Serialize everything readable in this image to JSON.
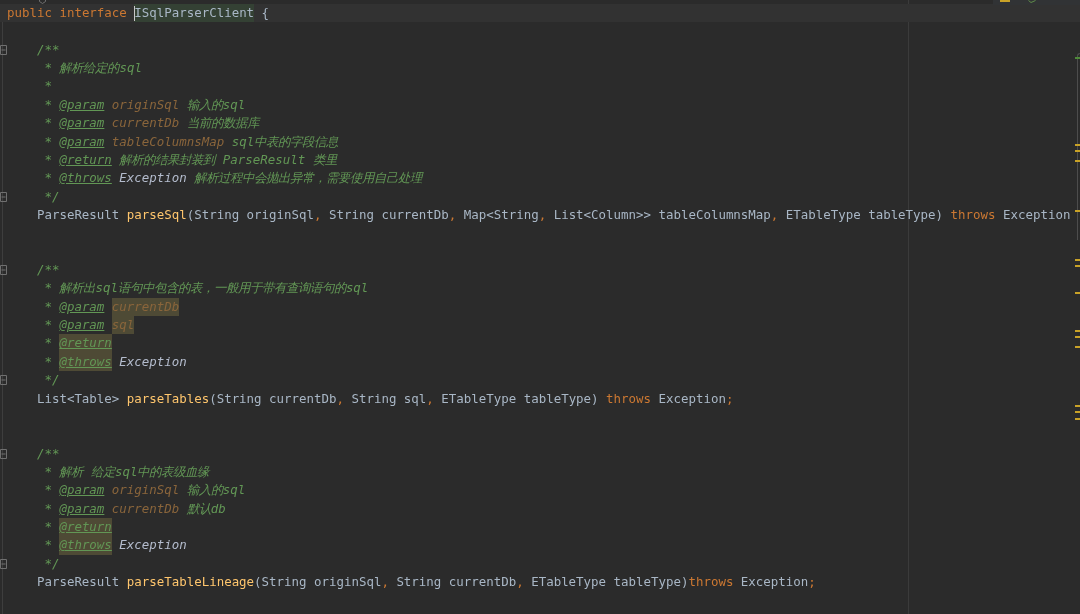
{
  "editor": {
    "lines": [
      {
        "kind": "declaration",
        "current": true,
        "tokens": [
          {
            "kind": "keyword",
            "text": "public interface "
          },
          {
            "kind": "class",
            "text": "ISqlParserClient",
            "selected": true,
            "caret": true
          },
          {
            "kind": "plain",
            "text": " {"
          }
        ]
      },
      {
        "kind": "blank"
      },
      {
        "kind": "doc-open",
        "tokens": [
          {
            "kind": "doc",
            "text": "/**"
          }
        ]
      },
      {
        "kind": "doc-body",
        "tokens": [
          {
            "kind": "doc",
            "text": "* 解析给定的sql"
          }
        ]
      },
      {
        "kind": "doc-body",
        "tokens": [
          {
            "kind": "doc",
            "text": "*"
          }
        ]
      },
      {
        "kind": "doc-body",
        "tokens": [
          {
            "kind": "doc",
            "text": "* "
          },
          {
            "kind": "doc-tag",
            "text": "@param"
          },
          {
            "kind": "doc-param",
            "text": " originSql"
          },
          {
            "kind": "doc",
            "text": " 输入的sql"
          }
        ]
      },
      {
        "kind": "doc-body",
        "tokens": [
          {
            "kind": "doc",
            "text": "* "
          },
          {
            "kind": "doc-tag",
            "text": "@param"
          },
          {
            "kind": "doc-param",
            "text": " currentDb"
          },
          {
            "kind": "doc",
            "text": " 当前的数据库"
          }
        ]
      },
      {
        "kind": "doc-body",
        "tokens": [
          {
            "kind": "doc",
            "text": "* "
          },
          {
            "kind": "doc-tag",
            "text": "@param"
          },
          {
            "kind": "doc-param",
            "text": " tableColumnsMap"
          },
          {
            "kind": "doc",
            "text": " sql中表的字段信息"
          }
        ]
      },
      {
        "kind": "doc-body",
        "tokens": [
          {
            "kind": "doc",
            "text": "* "
          },
          {
            "kind": "doc-tag",
            "text": "@return"
          },
          {
            "kind": "doc",
            "text": " 解析的结果封装到 ParseResult 类里"
          }
        ]
      },
      {
        "kind": "doc-body",
        "tokens": [
          {
            "kind": "doc",
            "text": "* "
          },
          {
            "kind": "doc-tag",
            "text": "@throws"
          },
          {
            "kind": "doc-ref",
            "text": " Exception"
          },
          {
            "kind": "doc",
            "text": " 解析过程中会抛出异常，需要使用自己处理"
          }
        ]
      },
      {
        "kind": "doc-close",
        "tokens": [
          {
            "kind": "doc",
            "text": "*/"
          }
        ]
      },
      {
        "kind": "signature",
        "tokens": [
          {
            "kind": "plain",
            "text": "ParseResult "
          },
          {
            "kind": "method",
            "text": "parseSql"
          },
          {
            "kind": "plain",
            "text": "(String originSql"
          },
          {
            "kind": "punct",
            "text": ","
          },
          {
            "kind": "plain",
            "text": " String currentDb"
          },
          {
            "kind": "punct",
            "text": ","
          },
          {
            "kind": "plain",
            "text": " Map<String"
          },
          {
            "kind": "punct",
            "text": ","
          },
          {
            "kind": "plain",
            "text": " List<Column>> tableColumnsMap"
          },
          {
            "kind": "punct",
            "text": ","
          },
          {
            "kind": "plain",
            "text": " ETableType tableType) "
          },
          {
            "kind": "keyword",
            "text": "throws"
          },
          {
            "kind": "plain",
            "text": " Exception"
          }
        ]
      },
      {
        "kind": "blank"
      },
      {
        "kind": "blank"
      },
      {
        "kind": "doc-open",
        "tokens": [
          {
            "kind": "doc",
            "text": "/**"
          }
        ]
      },
      {
        "kind": "doc-body",
        "tokens": [
          {
            "kind": "doc",
            "text": "* 解析出sql语句中包含的表，一般用于带有查询语句的sql"
          }
        ]
      },
      {
        "kind": "doc-body",
        "tokens": [
          {
            "kind": "doc",
            "text": "* "
          },
          {
            "kind": "doc-tag",
            "text": "@param"
          },
          {
            "kind": "doc-param",
            "text": " currentDb",
            "warning": true
          }
        ]
      },
      {
        "kind": "doc-body",
        "tokens": [
          {
            "kind": "doc",
            "text": "* "
          },
          {
            "kind": "doc-tag",
            "text": "@param"
          },
          {
            "kind": "doc-param",
            "text": " sql",
            "warning": true
          }
        ]
      },
      {
        "kind": "doc-body",
        "tokens": [
          {
            "kind": "doc",
            "text": "* "
          },
          {
            "kind": "doc-tag",
            "text": "@return",
            "warning": true
          }
        ]
      },
      {
        "kind": "doc-body",
        "tokens": [
          {
            "kind": "doc",
            "text": "* "
          },
          {
            "kind": "doc-tag",
            "text": "@throws",
            "warning": true
          },
          {
            "kind": "doc-ref",
            "text": " Exception"
          }
        ]
      },
      {
        "kind": "doc-close",
        "tokens": [
          {
            "kind": "doc",
            "text": "*/"
          }
        ]
      },
      {
        "kind": "signature",
        "tokens": [
          {
            "kind": "plain",
            "text": "List<Table> "
          },
          {
            "kind": "method",
            "text": "parseTables"
          },
          {
            "kind": "plain",
            "text": "(String currentDb"
          },
          {
            "kind": "punct",
            "text": ","
          },
          {
            "kind": "plain",
            "text": " String sql"
          },
          {
            "kind": "punct",
            "text": ","
          },
          {
            "kind": "plain",
            "text": " ETableType tableType) "
          },
          {
            "kind": "keyword",
            "text": "throws"
          },
          {
            "kind": "plain",
            "text": " Exception"
          },
          {
            "kind": "punct",
            "text": ";"
          }
        ]
      },
      {
        "kind": "blank"
      },
      {
        "kind": "blank"
      },
      {
        "kind": "doc-open",
        "tokens": [
          {
            "kind": "doc",
            "text": "/**"
          }
        ]
      },
      {
        "kind": "doc-body",
        "tokens": [
          {
            "kind": "doc",
            "text": "* 解析 给定sql中的表级血缘"
          }
        ]
      },
      {
        "kind": "doc-body",
        "tokens": [
          {
            "kind": "doc",
            "text": "* "
          },
          {
            "kind": "doc-tag",
            "text": "@param"
          },
          {
            "kind": "doc-param",
            "text": " originSql"
          },
          {
            "kind": "doc",
            "text": " 输入的sql"
          }
        ]
      },
      {
        "kind": "doc-body",
        "tokens": [
          {
            "kind": "doc",
            "text": "* "
          },
          {
            "kind": "doc-tag",
            "text": "@param"
          },
          {
            "kind": "doc-param",
            "text": " currentDb"
          },
          {
            "kind": "doc",
            "text": " 默认db"
          }
        ]
      },
      {
        "kind": "doc-body",
        "tokens": [
          {
            "kind": "doc",
            "text": "* "
          },
          {
            "kind": "doc-tag",
            "text": "@return",
            "warning": true
          }
        ]
      },
      {
        "kind": "doc-body",
        "tokens": [
          {
            "kind": "doc",
            "text": "* "
          },
          {
            "kind": "doc-tag",
            "text": "@throws",
            "warning": true
          },
          {
            "kind": "doc-ref",
            "text": " Exception"
          }
        ]
      },
      {
        "kind": "doc-close",
        "tokens": [
          {
            "kind": "doc",
            "text": "*/"
          }
        ]
      },
      {
        "kind": "signature",
        "tokens": [
          {
            "kind": "plain",
            "text": "ParseResult "
          },
          {
            "kind": "method",
            "text": "parseTableLineage"
          },
          {
            "kind": "plain",
            "text": "(String originSql"
          },
          {
            "kind": "punct",
            "text": ","
          },
          {
            "kind": "plain",
            "text": " String currentDb"
          },
          {
            "kind": "punct",
            "text": ","
          },
          {
            "kind": "plain",
            "text": " ETableType tableType)"
          },
          {
            "kind": "keyword",
            "text": "throws"
          },
          {
            "kind": "plain",
            "text": " Exception"
          },
          {
            "kind": "punct",
            "text": ";"
          }
        ]
      },
      {
        "kind": "blank"
      }
    ]
  }
}
